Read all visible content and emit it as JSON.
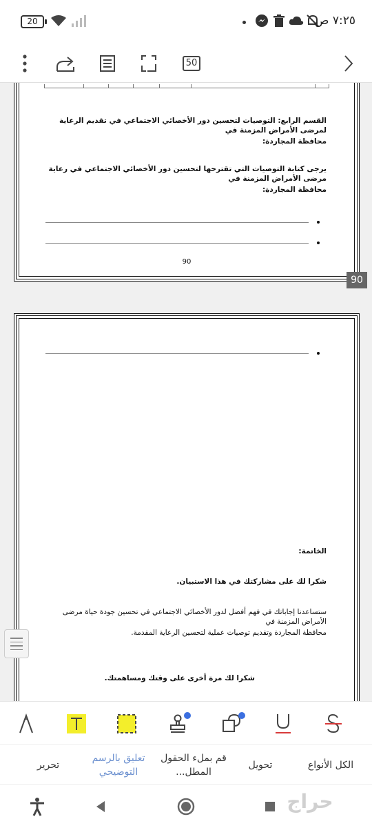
{
  "status_bar": {
    "time": "٧:٢٥ ص",
    "battery": "20"
  },
  "toolbar": {
    "page_number": "50"
  },
  "page1": {
    "section4_title": "القسم الرابع: التوصيات لتحسين دور الأخصائي الاجتماعي في تقديم الرعاية لمرضى الأمراض المزمنة في",
    "section4_title_cont": "محافظة المجاردة:",
    "request_text": "يرجى كتابة التوصيات التي تقترحها لتحسين دور الأخصائي الاجتماعي في رعاية مرضى الأمراض المزمنة في",
    "request_text_cont": "محافظة المجاردة:",
    "page_footer": "90"
  },
  "page_badge": "90",
  "page2": {
    "conclusion_heading": "الخاتمة:",
    "thanks_text": "شكرا لك على مشاركتك في هذا الاستبيان.",
    "paragraph": "ستساعدنا إجاباتك في فهم أفضل لدور الأخصائي الاجتماعي في تحسين جودة حياة مرضى الأمراض المزمنة في",
    "paragraph_cont": "محافظة المجاردة وتقديم توصيات عملية لتحسين الرعاية المقدمة.",
    "final_thanks": "شكرا لك مرة أخرى على وقتك ومساهمتك."
  },
  "tabs": [
    {
      "label": "الكل الأنواع"
    },
    {
      "label": "تحويل"
    },
    {
      "label": "قم بملء الحقول المطل..."
    },
    {
      "label": "تعليق بالرسم التوضيحي"
    },
    {
      "label": "تحرير"
    }
  ],
  "watermark": "حراج",
  "colors": {
    "accent_blue": "#6a8fcf",
    "highlight_yellow": "#f3ee2b",
    "underline_red": "#d83a3a",
    "badge_blue": "#3b6fe0"
  },
  "icons": {
    "annotation_tools": [
      "strikethrough-icon",
      "underline-icon",
      "shapes-icon",
      "stamp-icon",
      "area-highlight-icon",
      "text-highlight-icon",
      "pen-icon"
    ]
  }
}
